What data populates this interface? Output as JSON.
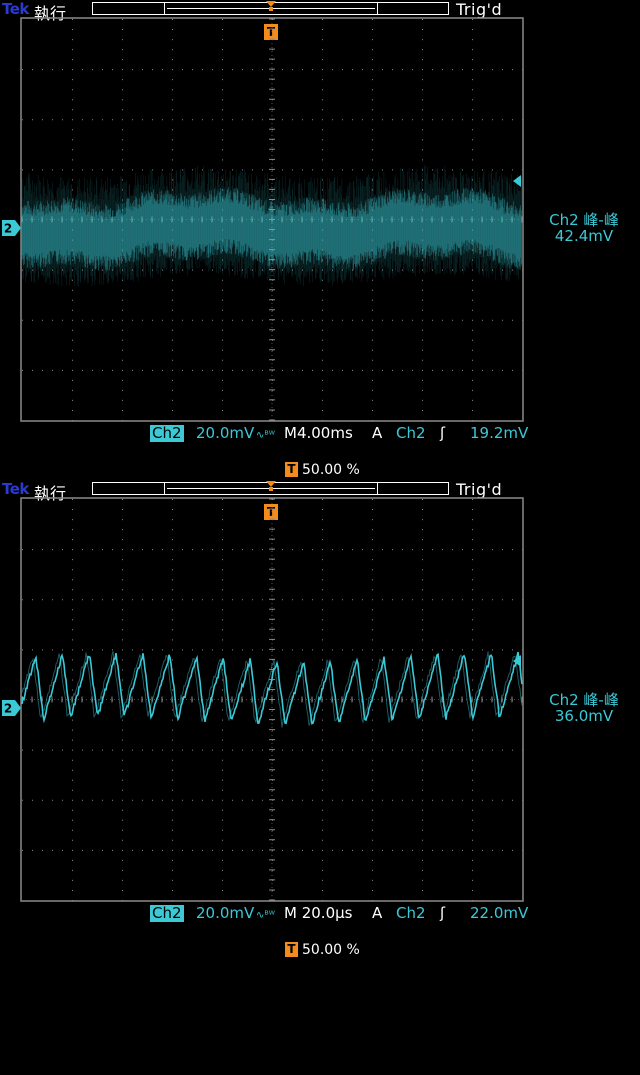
{
  "screens": [
    {
      "brand": "Tek",
      "mode": "執行",
      "trigger_status": "Trig'd",
      "trigger_marker": "T",
      "channel_marker": "2",
      "measurement": {
        "label": "Ch2 峰-峰",
        "value": "42.4mV"
      },
      "status": {
        "channel": "Ch2",
        "volts_div": "20.0mV",
        "bw_symbol": "∿ᴮᵂ",
        "timebase": "M4.00ms",
        "trigger_type": "A",
        "trigger_source": "Ch2",
        "trigger_slope": "ʃ",
        "trigger_level": "19.2mV"
      },
      "trigger_position": "50.00 %",
      "waveform": {
        "kind": "noise",
        "color": "#3cc9d6"
      }
    },
    {
      "brand": "Tek",
      "mode": "執行",
      "trigger_status": "Trig'd",
      "trigger_marker": "T",
      "channel_marker": "2",
      "measurement": {
        "label": "Ch2 峰-峰",
        "value": "36.0mV"
      },
      "status": {
        "channel": "Ch2",
        "volts_div": "20.0mV",
        "bw_symbol": "∿ᴮᵂ",
        "timebase": "M 20.0µs",
        "trigger_type": "A",
        "trigger_source": "Ch2",
        "trigger_slope": "ʃ",
        "trigger_level": "22.0mV"
      },
      "trigger_position": "50.00 %",
      "waveform": {
        "kind": "sawtooth",
        "color": "#3cc9d6"
      }
    }
  ],
  "colors": {
    "trace": "#3cc9d6",
    "marker": "#f28c1a",
    "grid": "#8a8a8a",
    "brand": "#2a3bd0"
  }
}
